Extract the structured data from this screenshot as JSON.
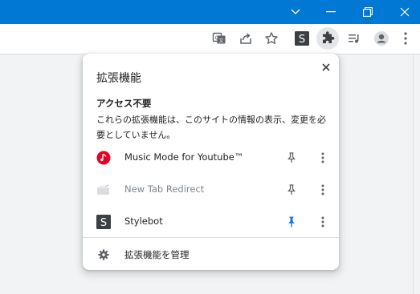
{
  "colors": {
    "titlebar": "#0078d4",
    "pinned": "#1a73e8",
    "icon_gray": "#5f6368",
    "music_red": "#e60023",
    "stylebot_dark": "#3c4043"
  },
  "toolbar": {
    "icons": [
      "translate-icon",
      "share-icon",
      "star-icon",
      "stylebot-icon",
      "extensions-puzzle-icon",
      "reading-list-icon",
      "profile-icon",
      "more-vertical-icon"
    ],
    "stylebot_letter": "S"
  },
  "popup": {
    "title": "拡張機能",
    "close_glyph": "✕",
    "section_title": "アクセス不要",
    "section_desc": "これらの拡張機能は、このサイトの情報の表示、変更を必要としていません。",
    "extensions": [
      {
        "name": "Music Mode for Youtube™",
        "icon": "music-note-icon",
        "pinned": false,
        "muted": false
      },
      {
        "name": "New Tab Redirect",
        "icon": "new-tab-redirect-icon",
        "pinned": false,
        "muted": true
      },
      {
        "name": "Stylebot",
        "icon": "stylebot-icon",
        "pinned": true,
        "muted": false,
        "letter": "S"
      }
    ],
    "manage_label": "拡張機能を管理"
  }
}
